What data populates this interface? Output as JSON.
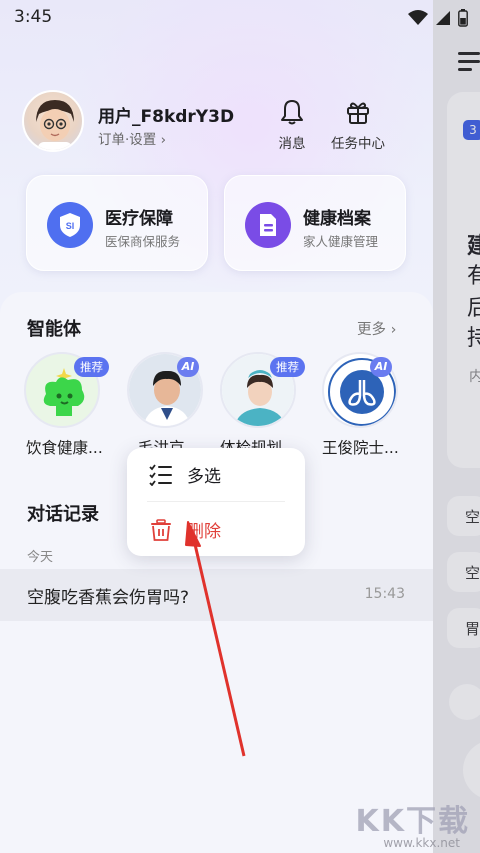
{
  "status_bar": {
    "time": "3:45"
  },
  "profile": {
    "username": "用户_F8kdrY3D",
    "sub_links": "订单·设置 ›"
  },
  "top_actions": [
    {
      "label": "消息",
      "icon": "bell-icon"
    },
    {
      "label": "任务中心",
      "icon": "gift-icon"
    }
  ],
  "service_cards": [
    {
      "title": "医疗保障",
      "subtitle": "医保商保服务",
      "icon": "si-shield-icon",
      "color": "#4f6ff0"
    },
    {
      "title": "健康档案",
      "subtitle": "家人健康管理",
      "icon": "record-icon",
      "color": "#7a4ce6"
    }
  ],
  "agents_section": {
    "title": "智能体",
    "more_label": "更多 ›",
    "agents": [
      {
        "name": "饮食健康...",
        "badge": "推荐"
      },
      {
        "name": "毛洪京...",
        "badge": "AI"
      },
      {
        "name": "体检规划...",
        "badge": "推荐"
      },
      {
        "name": "王俊院士...",
        "badge": "AI"
      }
    ]
  },
  "history_section": {
    "title": "对话记录",
    "day_label": "今天",
    "items": [
      {
        "question": "空腹吃香蕉会伤胃吗?",
        "time": "15:43"
      }
    ]
  },
  "context_menu": {
    "items": [
      {
        "label": "多选",
        "icon": "list-check-icon"
      },
      {
        "label": "删除",
        "icon": "trash-icon"
      }
    ]
  },
  "behind_page": {
    "badge": "3",
    "text_fragments": [
      "建",
      "有",
      "后",
      "持",
      "内"
    ],
    "chips": [
      "空",
      "空",
      "胃"
    ]
  },
  "watermark": {
    "text": "KK下载",
    "url": "www.kkx.net"
  },
  "colors": {
    "accent_blue": "#4f6ff0",
    "purple": "#7a4ce6",
    "delete_red": "#e0403a",
    "arrow_red": "#e0322c"
  }
}
